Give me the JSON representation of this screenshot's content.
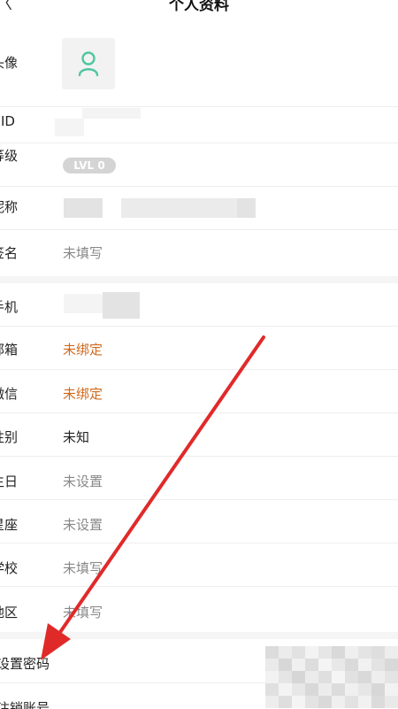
{
  "header": {
    "back_glyph": "〈",
    "title": "个人资料"
  },
  "profile": {
    "avatar_label": "头像",
    "uid_label": "UID",
    "level_label": "等级",
    "level_value": "LVL 0",
    "nickname_label": "昵称",
    "signature_label": "签名",
    "signature_value": "未填写"
  },
  "contact": {
    "phone_label": "手机",
    "email_label": "邮箱",
    "email_value": "未绑定",
    "wechat_label": "微信",
    "wechat_value": "未绑定",
    "gender_label": "性别",
    "gender_value": "未知",
    "birthday_label": "生日",
    "birthday_value": "未设置",
    "zodiac_label": "星座",
    "zodiac_value": "未设置",
    "school_label": "学校",
    "school_value": "未填写",
    "region_label": "地区",
    "region_value": "未填写"
  },
  "account": {
    "set_password_label": "设置密码",
    "cancel_account_label": "注销账号"
  },
  "colors": {
    "accent_teal": "#4fc6a0",
    "unbound_orange": "#d1691c",
    "annotation_red": "#e02a2a"
  },
  "icons": {
    "avatar": "user-avatar-icon",
    "back": "back-arrow-icon"
  }
}
